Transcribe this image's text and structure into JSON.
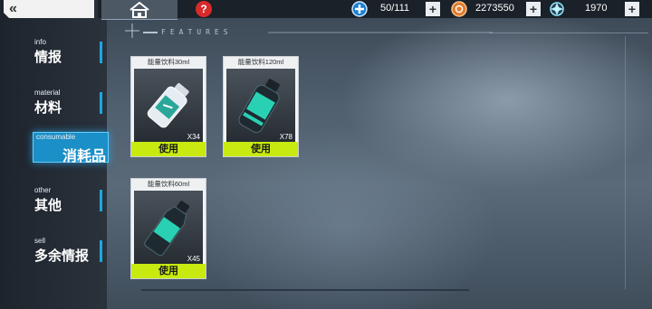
{
  "back": {
    "label": "«",
    "icon": "double-chevron-left-icon"
  },
  "top_bar": {
    "home_icon": "home-icon",
    "help": {
      "icon": "help-icon",
      "label": "?"
    },
    "resources": [
      {
        "icon": "plus-circle-icon",
        "value": "50/111"
      },
      {
        "icon": "gear-coin-icon",
        "value": "2273550"
      },
      {
        "icon": "energy-gem-icon",
        "value": "1970"
      }
    ]
  },
  "features_label": "FEATURES",
  "sidebar": {
    "items": [
      {
        "en": "info",
        "zh": "情报"
      },
      {
        "en": "material",
        "zh": "材料"
      },
      {
        "en": "consumable",
        "zh": "消耗品"
      },
      {
        "en": "other",
        "zh": "其他"
      },
      {
        "en": "sell",
        "zh": "多余情报"
      }
    ],
    "active_index": 2
  },
  "items": [
    {
      "name": "能量饮料30ml",
      "qty": "X34",
      "use_label": "使用",
      "icon": "energy-drink-small-icon"
    },
    {
      "name": "能量饮料120ml",
      "qty": "X78",
      "use_label": "使用",
      "icon": "energy-drink-large-icon"
    },
    {
      "name": "能量饮料60ml",
      "qty": "X45",
      "use_label": "使用",
      "icon": "energy-drink-medium-icon"
    }
  ],
  "colors": {
    "accent": "#1aa8e0",
    "use_button": "#c8ea10",
    "help": "#d92a2a"
  }
}
